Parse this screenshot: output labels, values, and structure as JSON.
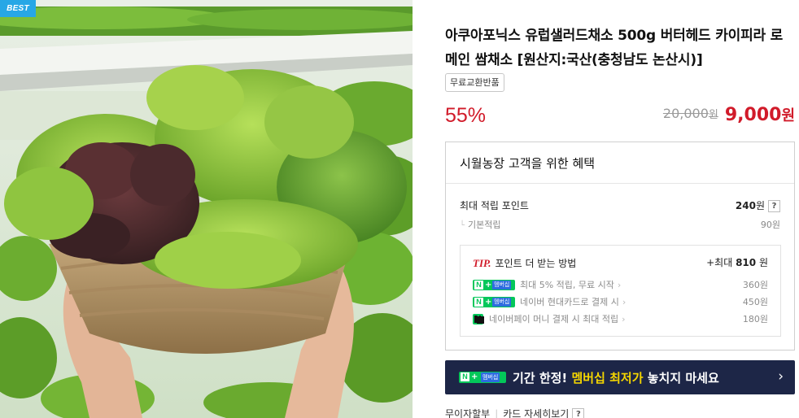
{
  "image": {
    "badge": "BEST",
    "alt_icon": "lettuce-basket-photo"
  },
  "product": {
    "title": "아쿠아포닉스 유럽샐러드채소 500g 버터헤드 카이피라 로메인 쌈채소 [원산지:국산(충청남도 논산시)]",
    "tag": "무료교환반품",
    "discount": "55%",
    "original_price": "20,000",
    "sale_price": "9,000",
    "won": "원"
  },
  "benefit": {
    "heading": "시월농장 고객을 위한 혜택",
    "max_points_label": "최대 적립 포인트",
    "max_points_value": "240",
    "basic_label": "기본적립",
    "basic_value": "90원",
    "tip": {
      "mark": "TIP.",
      "heading": "포인트 더 받는 방법",
      "total_prefix": "+최대",
      "total_value": "810",
      "rows": [
        {
          "badge": "N+ 멤버십",
          "label": "최대 5% 적립, 무료 시작",
          "value": "360원"
        },
        {
          "badge": "N+ 멤버십",
          "label": "네이버 현대카드로 결제 시",
          "value": "450원"
        },
        {
          "badge": "N pay",
          "label": "네이버페이 머니 결제 시 최대 적립",
          "value": "180원"
        }
      ]
    }
  },
  "badge_text": {
    "n": "N",
    "plus": "+",
    "membership": "멤버십",
    "npay": "N"
  },
  "banner": {
    "text_before": "기간 한정! ",
    "text_highlight": "멤버십 최저가",
    "text_after": " 놓치지 마세요",
    "arrow": "›"
  },
  "footer": {
    "installment": "무이자할부",
    "card_detail": "카드 자세히보기"
  },
  "icons": {
    "help": "?",
    "chevron": "›",
    "branch": "└"
  },
  "colors": {
    "accent_red": "#d11b2a",
    "naver_green": "#03c75a",
    "banner_navy": "#1d2647",
    "banner_highlight": "#f5d600",
    "best_badge": "#27a7e6"
  }
}
